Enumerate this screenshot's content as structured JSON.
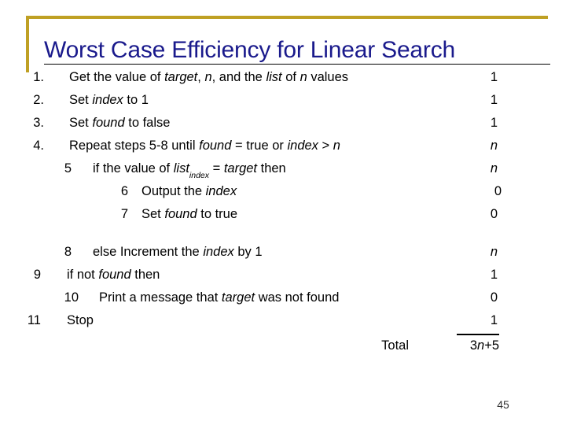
{
  "slide": {
    "title": "Worst Case Efficiency for Linear Search",
    "page_number": "45",
    "accent_color": "#BFA024",
    "title_color": "#1A1A8C",
    "text_color": "#000000"
  },
  "algorithm": {
    "total_label": "Total",
    "total_value_prefix": "3",
    "total_value_var": "n",
    "total_value_suffix": "+5",
    "steps": [
      {
        "number": "1.",
        "text_parts": [
          {
            "t": "Get the value of ",
            "style": "normal"
          },
          {
            "t": "target",
            "style": "italic"
          },
          {
            "t": ", ",
            "style": "normal"
          },
          {
            "t": "n",
            "style": "italic"
          },
          {
            "t": ", and the ",
            "style": "normal"
          },
          {
            "t": "list",
            "style": "italic"
          },
          {
            "t": " of ",
            "style": "normal"
          },
          {
            "t": "n",
            "style": "italic"
          },
          {
            "t": " values",
            "style": "normal"
          }
        ],
        "cost": "1"
      },
      {
        "number": "2.",
        "text_parts": [
          {
            "t": "Set ",
            "style": "normal"
          },
          {
            "t": "index",
            "style": "italic"
          },
          {
            "t": " to 1",
            "style": "normal"
          }
        ],
        "cost": "1"
      },
      {
        "number": "3.",
        "text_parts": [
          {
            "t": "Set ",
            "style": "normal"
          },
          {
            "t": "found",
            "style": "italic"
          },
          {
            "t": " to false",
            "style": "normal"
          }
        ],
        "cost": "1"
      },
      {
        "number": "4.",
        "text_parts": [
          {
            "t": "Repeat steps 5-8 until ",
            "style": "normal"
          },
          {
            "t": "found",
            "style": "italic"
          },
          {
            "t": " = true or ",
            "style": "normal"
          },
          {
            "t": "index",
            "style": "italic"
          },
          {
            "t": " > ",
            "style": "normal"
          },
          {
            "t": "n",
            "style": "italic"
          }
        ],
        "cost": "n",
        "cost_italic": true
      },
      {
        "number": "5",
        "text_parts": [
          {
            "t": "if the value of ",
            "style": "normal"
          },
          {
            "t": "list",
            "style": "italic"
          },
          {
            "t": "index",
            "style": "subscript"
          },
          {
            "t": " = ",
            "style": "normal"
          },
          {
            "t": "target",
            "style": "italic"
          },
          {
            "t": " then",
            "style": "normal"
          }
        ],
        "cost": "n",
        "cost_italic": true
      },
      {
        "number": "6",
        "text_parts": [
          {
            "t": "Output the ",
            "style": "normal"
          },
          {
            "t": "index",
            "style": "italic"
          }
        ],
        "cost": "0"
      },
      {
        "number": "7",
        "text_parts": [
          {
            "t": "Set ",
            "style": "normal"
          },
          {
            "t": "found",
            "style": "italic"
          },
          {
            "t": " to true",
            "style": "normal"
          }
        ],
        "cost": "0"
      },
      {
        "number": "8",
        "text_parts": [
          {
            "t": "else Increment the ",
            "style": "normal"
          },
          {
            "t": "index",
            "style": "italic"
          },
          {
            "t": " by 1",
            "style": "normal"
          }
        ],
        "cost": "n",
        "cost_italic": true
      },
      {
        "number": "9",
        "text_parts": [
          {
            "t": "if not ",
            "style": "normal"
          },
          {
            "t": "found",
            "style": "italic"
          },
          {
            "t": " then",
            "style": "normal"
          }
        ],
        "cost": "1"
      },
      {
        "number": "10",
        "text_parts": [
          {
            "t": "Print a message that ",
            "style": "normal"
          },
          {
            "t": "target",
            "style": "italic"
          },
          {
            "t": " was not found",
            "style": "normal"
          }
        ],
        "cost": "0"
      },
      {
        "number": "11",
        "text_parts": [
          {
            "t": "Stop",
            "style": "normal"
          }
        ],
        "cost": "1"
      }
    ]
  }
}
